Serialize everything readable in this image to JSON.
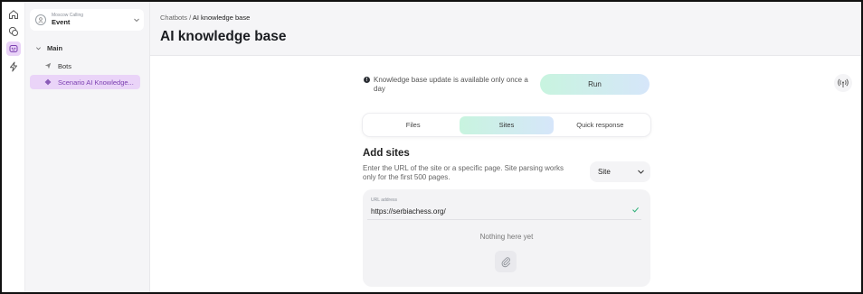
{
  "workspace": {
    "org": "Moscow Calling",
    "name": "Event"
  },
  "rail": {
    "icons": [
      "home-icon",
      "chats-icon",
      "chatbot-icon",
      "lightning-icon"
    ]
  },
  "sidebar": {
    "group_label": "Main",
    "items": [
      {
        "label": "Bots",
        "icon": "send-icon"
      },
      {
        "label": "Scenario AI Knowledge...",
        "icon": "diamond-icon",
        "active": true
      }
    ]
  },
  "header": {
    "breadcrumb": {
      "parent": "Chatbots",
      "separator": " / ",
      "current": "AI knowledge base"
    },
    "title": "AI knowledge base"
  },
  "notice": {
    "icon_text": "!",
    "text": "Knowledge base update is available only once a day"
  },
  "run_label": "Run",
  "tabs": [
    {
      "label": "Files"
    },
    {
      "label": "Sites",
      "active": true
    },
    {
      "label": "Quick response"
    }
  ],
  "section": {
    "title": "Add sites",
    "description": "Enter the URL of the site or a specific page. Site parsing works only for the first 500 pages."
  },
  "select": {
    "value": "Site"
  },
  "url_field": {
    "label": "URL address",
    "value": "https://serbiachess.org/"
  },
  "empty_text": "Nothing here yet",
  "colors": {
    "accent_gradient_start": "#c8f4df",
    "accent_gradient_end": "#d6e6fa",
    "active_nav": "#ead4f8",
    "active_nav_text": "#7b3fb0",
    "check": "#35b37e"
  }
}
